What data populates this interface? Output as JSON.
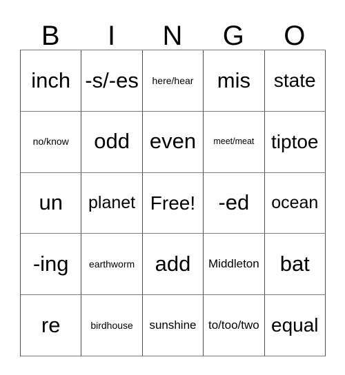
{
  "card": {
    "headers": [
      "B",
      "I",
      "N",
      "G",
      "O"
    ],
    "rows": [
      [
        {
          "text": "inch",
          "size": "sz-xl"
        },
        {
          "text": "-s/-es",
          "size": "sz-xl"
        },
        {
          "text": "here/hear",
          "size": "sz-xs"
        },
        {
          "text": "mis",
          "size": "sz-xl"
        },
        {
          "text": "state",
          "size": "sz-lg"
        }
      ],
      [
        {
          "text": "no/know",
          "size": "sz-xs"
        },
        {
          "text": "odd",
          "size": "sz-xl"
        },
        {
          "text": "even",
          "size": "sz-xl"
        },
        {
          "text": "meet/meat",
          "size": "sz-xxs"
        },
        {
          "text": "tiptoe",
          "size": "sz-lg"
        }
      ],
      [
        {
          "text": "un",
          "size": "sz-xl"
        },
        {
          "text": "planet",
          "size": "sz-md"
        },
        {
          "text": "Free!",
          "size": "sz-lg"
        },
        {
          "text": "-ed",
          "size": "sz-xl"
        },
        {
          "text": "ocean",
          "size": "sz-md"
        }
      ],
      [
        {
          "text": "-ing",
          "size": "sz-xl"
        },
        {
          "text": "earthworm",
          "size": "sz-xs"
        },
        {
          "text": "add",
          "size": "sz-xl"
        },
        {
          "text": "Middleton",
          "size": "sz-sm"
        },
        {
          "text": "bat",
          "size": "sz-xl"
        }
      ],
      [
        {
          "text": "re",
          "size": "sz-xl"
        },
        {
          "text": "birdhouse",
          "size": "sz-xs"
        },
        {
          "text": "sunshine",
          "size": "sz-sm"
        },
        {
          "text": "to/too/two",
          "size": "sz-sm"
        },
        {
          "text": "equal",
          "size": "sz-lg"
        }
      ]
    ]
  }
}
